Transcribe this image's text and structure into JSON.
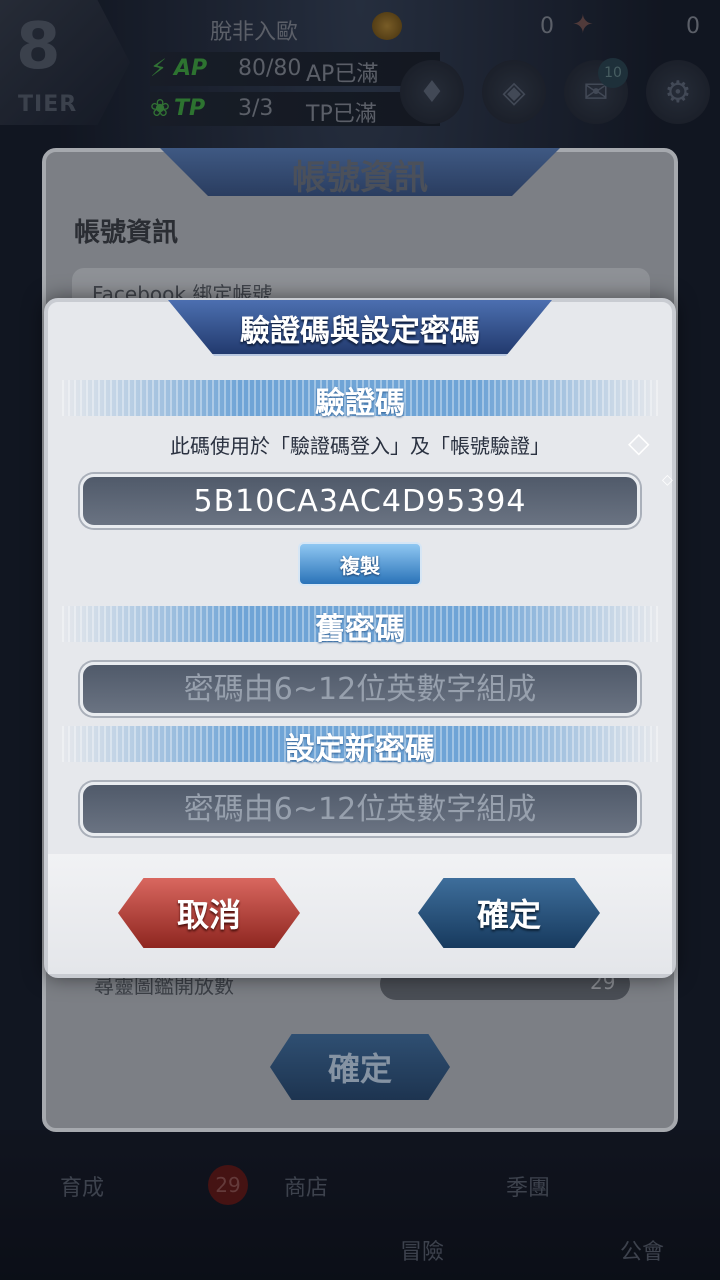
{
  "hud": {
    "tier_number": "8",
    "tier_label": "TIER",
    "player_name": "脫非入歐",
    "currency_a": "0",
    "currency_b": "0",
    "ap_key": "AP",
    "ap_value": "80/80",
    "ap_status": "AP已滿",
    "tp_key": "TP",
    "tp_value": "3/3",
    "tp_status": "TP已滿",
    "mail_badge": "10"
  },
  "bottom_nav": {
    "item_1": "育成",
    "item_2": "商店",
    "item_3": "冒險",
    "item_4": "季團",
    "item_5": "公會",
    "badge": "29"
  },
  "account_panel": {
    "title": "帳號資訊",
    "heading": "帳號資訊",
    "facebook_label": "Facebook 綁定帳號",
    "collection_label": "尋靈圖鑑開放數",
    "collection_value": "29",
    "confirm_label": "確定"
  },
  "dialog": {
    "title": "驗證碼與設定密碼",
    "code_section": "驗證碼",
    "hint": "此碼使用於「驗證碼登入」及「帳號驗證」",
    "code": "5B10CA3AC4D95394",
    "copy_label": "複製",
    "old_password_section": "舊密碼",
    "old_password_placeholder": "密碼由6~12位英數字組成",
    "new_password_section": "設定新密碼",
    "new_password_placeholder": "密碼由6~12位英數字組成",
    "cancel_label": "取消",
    "confirm_label": "確定"
  },
  "colors": {
    "accent_blue": "#6fa4d6",
    "cancel_red": "#b53a33",
    "confirm_blue": "#264d75"
  }
}
